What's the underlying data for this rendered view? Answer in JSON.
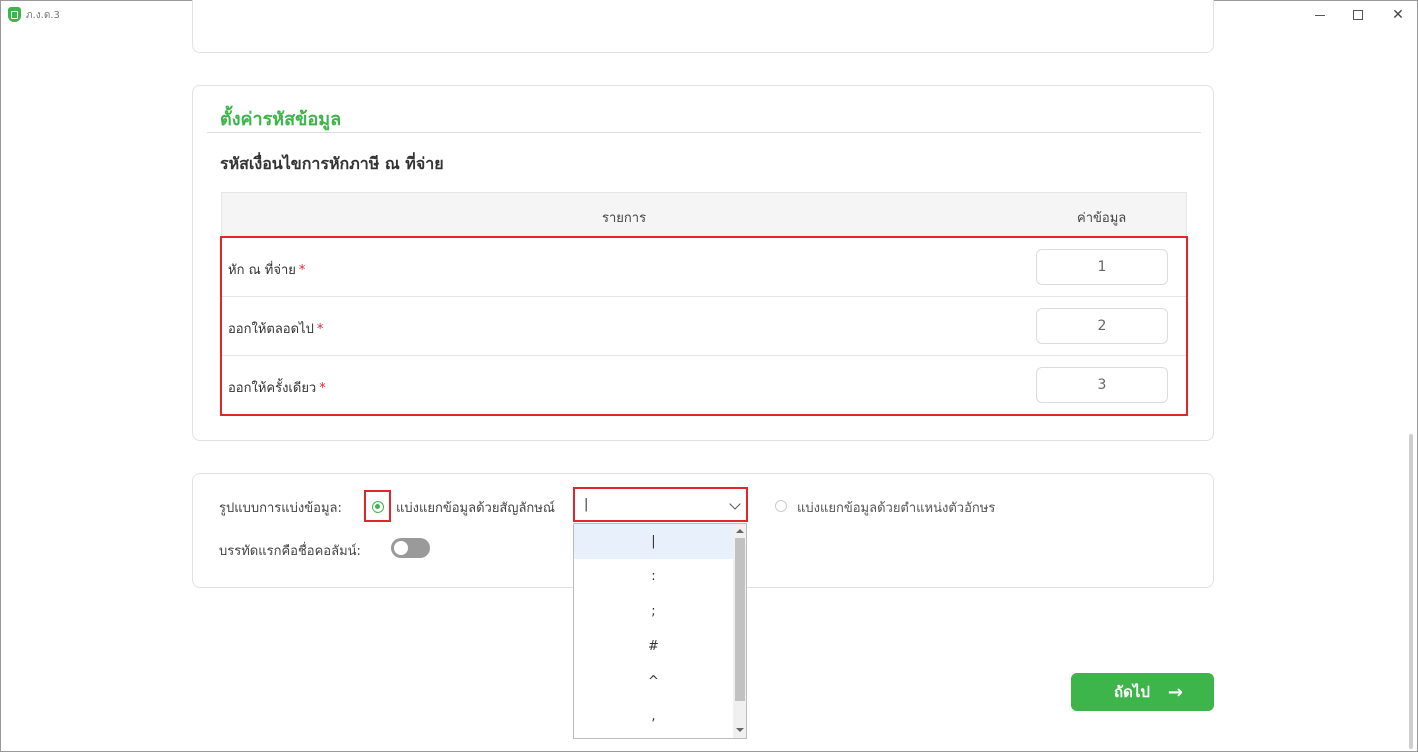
{
  "window": {
    "title": "ภ.ง.ด.3"
  },
  "code_settings": {
    "section_title": "ตั้งค่ารหัสข้อมูล",
    "sub_title": "รหัสเงื่อนไขการหักภาษี ณ ที่จ่าย",
    "columns": [
      "รายการ",
      "ค่าข้อมูล"
    ],
    "rows": [
      {
        "label": "หัก ณ ที่จ่าย",
        "required_mark": "*",
        "value": "1"
      },
      {
        "label": "ออกให้ตลอดไป",
        "required_mark": "*",
        "value": "2"
      },
      {
        "label": "ออกให้ครั้งเดียว",
        "required_mark": "*",
        "value": "3"
      }
    ]
  },
  "split_format": {
    "label": "รูปแบบการแบ่งข้อมูล:",
    "option_symbol": "แบ่งแยกข้อมูลด้วยสัญลักษณ์",
    "option_position": "แบ่งแยกข้อมูลด้วยตำแหน่งตัวอักษร",
    "selected_symbol": "|",
    "symbol_options": [
      "|",
      ":",
      ";",
      "#",
      "^",
      ","
    ],
    "header_row_label": "บรรทัดแรกคือชื่อคอลัมน์:",
    "header_row_enabled": false
  },
  "actions": {
    "next_label": "ถัดไป"
  },
  "colors": {
    "accent": "#3db54a",
    "highlight": "#e3262b"
  }
}
